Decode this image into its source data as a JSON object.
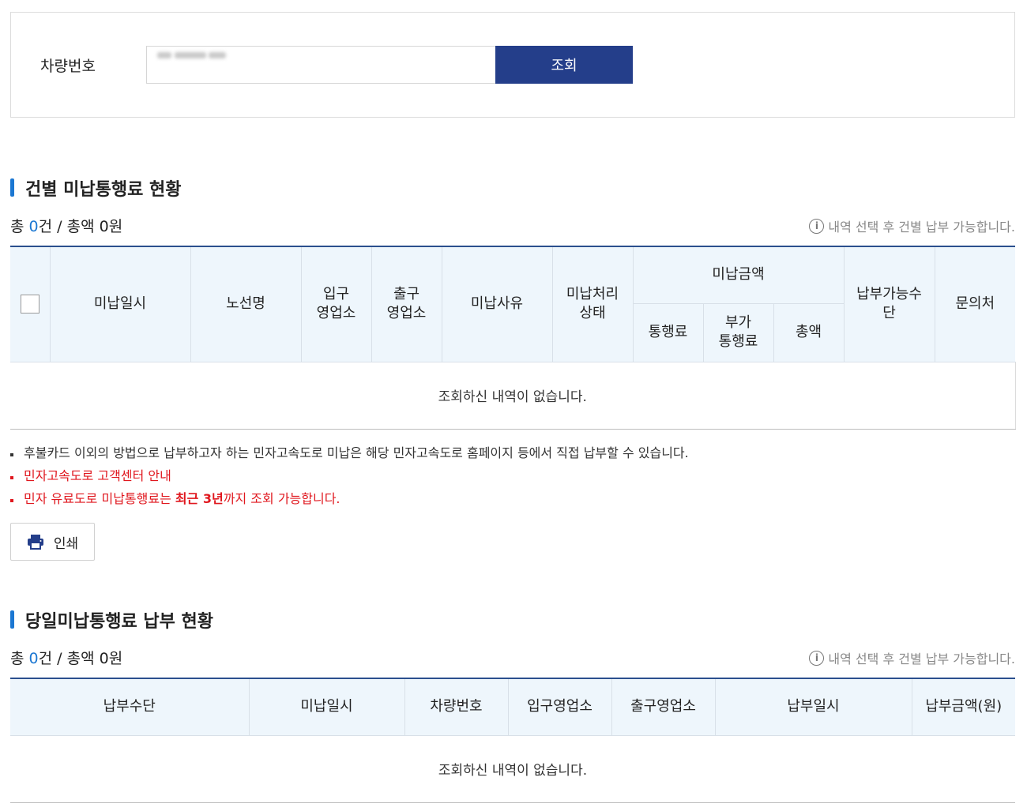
{
  "search": {
    "label": "차량번호",
    "input_value": "",
    "button_label": "조회"
  },
  "section1": {
    "title": "건별 미납통행료 현황",
    "summary_prefix": "총 ",
    "count": "0",
    "summary_mid": "건 / 총액 ",
    "total": "0",
    "summary_suffix": "원",
    "notice": "내역 선택 후 건별 납부 가능합니다.",
    "headers": {
      "date": "미납일시",
      "route": "노선명",
      "entry": "입구\n영업소",
      "exit": "출구\n영업소",
      "reason": "미납사유",
      "status": "미납처리\n상태",
      "amount": "미납금액",
      "toll": "통행료",
      "extra": "부가\n통행료",
      "sum": "총액",
      "payment": "납부가능수\n단",
      "contact": "문의처"
    },
    "empty_message": "조회하신 내역이 없습니다."
  },
  "notes": [
    {
      "text": "후불카드 이외의 방법으로 납부하고자 하는 민자고속도로 미납은 해당 민자고속도로 홈페이지 등에서 직접 납부할 수 있습니다."
    },
    {
      "text": "민자고속도로 고객센터 안내"
    },
    {
      "prefix": "민자 유료도로 미납통행료는 ",
      "bold": "최근 3년",
      "suffix": "까지 조회 가능합니다."
    }
  ],
  "print_label": "인쇄",
  "section2": {
    "title": "당일미납통행료 납부 현황",
    "summary_prefix": "총 ",
    "count": "0",
    "summary_mid": "건 / 총액 ",
    "total": "0",
    "summary_suffix": "원",
    "notice": "내역 선택 후 건별 납부 가능합니다.",
    "headers": [
      "납부수단",
      "미납일시",
      "차량번호",
      "입구영업소",
      "출구영업소",
      "납부일시",
      "납부금액(원)"
    ],
    "empty_message": "조회하신 내역이 없습니다."
  },
  "colors": {
    "primary": "#243e8a",
    "accent": "#1b77d2",
    "header_bg": "#eef6fc",
    "warning": "#e0171e"
  }
}
